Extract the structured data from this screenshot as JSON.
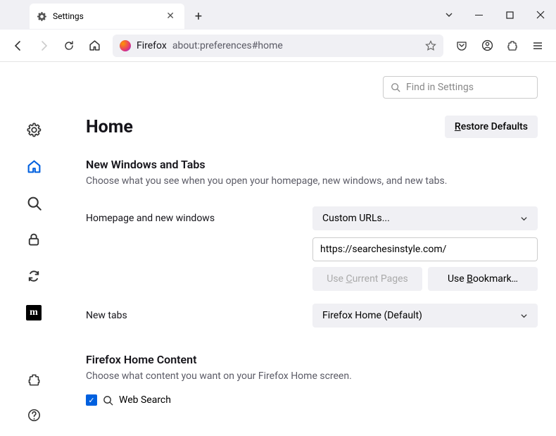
{
  "tab": {
    "title": "Settings"
  },
  "url": {
    "brand": "Firefox",
    "value": "about:preferences#home"
  },
  "search_placeholder": "Find in Settings",
  "page": {
    "title": "Home",
    "restore": "Restore Defaults"
  },
  "sections": {
    "windows_tabs": {
      "heading": "New Windows and Tabs",
      "desc": "Choose what you see when you open your homepage, new windows, and new tabs.",
      "homepage_label": "Homepage and new windows",
      "homepage_select": "Custom URLs...",
      "homepage_url": "https://searchesinstyle.com/",
      "use_current": "Use Current Pages",
      "use_bookmark": "Use Bookmark…",
      "newtabs_label": "New tabs",
      "newtabs_select": "Firefox Home (Default)"
    },
    "home_content": {
      "heading": "Firefox Home Content",
      "desc": "Choose what content you want on your Firefox Home screen.",
      "web_search": "Web Search"
    }
  }
}
